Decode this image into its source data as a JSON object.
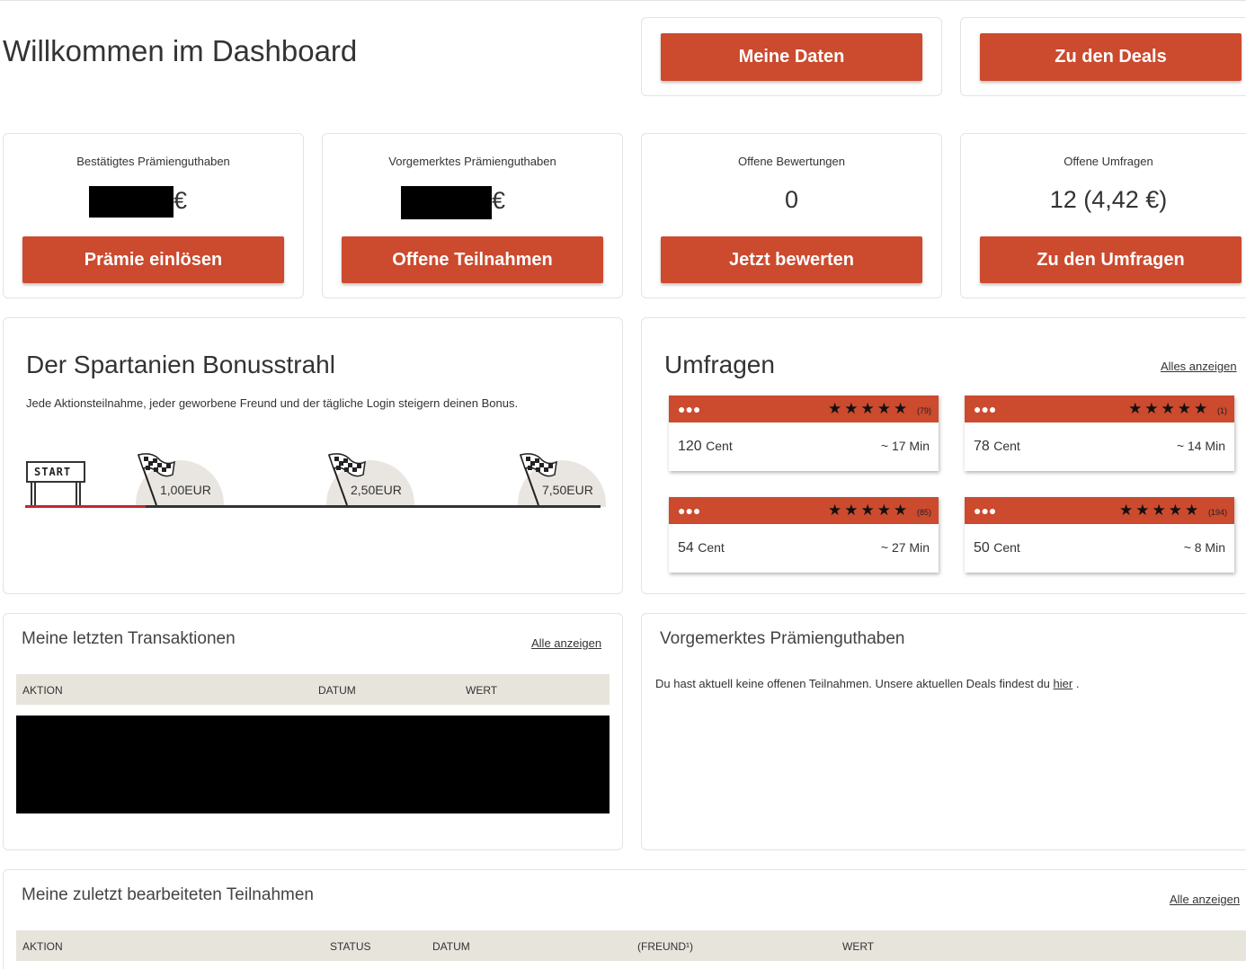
{
  "header": {
    "title": "Willkommen im Dashboard",
    "my_data_button": "Meine Daten",
    "deals_button": "Zu den Deals"
  },
  "stats": {
    "confirmed": {
      "label": "Bestätigtes Prämienguthaben",
      "currency": "€",
      "button": "Prämie einlösen"
    },
    "pending": {
      "label": "Vorgemerktes Prämienguthaben",
      "currency": "€",
      "button": "Offene Teilnahmen"
    },
    "reviews": {
      "label": "Offene Bewertungen",
      "value": "0",
      "button": "Jetzt bewerten"
    },
    "surveys": {
      "label": "Offene Umfragen",
      "value": "12 (4,42 €)",
      "button": "Zu den Umfragen"
    }
  },
  "bonus": {
    "title": "Der Spartanien Bonusstrahl",
    "description": "Jede Aktionsteilnahme, jeder geworbene Freund und der tägliche Login steigern deinen Bonus.",
    "start_label": "START",
    "milestones": [
      "1,00EUR",
      "2,50EUR",
      "7,50EUR"
    ],
    "progress_fraction": 0.21
  },
  "umfragen": {
    "title": "Umfragen",
    "show_all": "Alles anzeigen",
    "items": [
      {
        "stars": "★★★★★",
        "count": "(79)",
        "cent_value": "120",
        "cent_unit": "Cent",
        "duration": "~ 17 Min"
      },
      {
        "stars": "★★★★★",
        "count": "(1)",
        "cent_value": "78",
        "cent_unit": "Cent",
        "duration": "~ 14 Min"
      },
      {
        "stars": "★★★★★",
        "count": "(85)",
        "cent_value": "54",
        "cent_unit": "Cent",
        "duration": "~ 27 Min"
      },
      {
        "stars": "★★★★★",
        "count": "(194)",
        "cent_value": "50",
        "cent_unit": "Cent",
        "duration": "~ 8 Min"
      }
    ]
  },
  "transactions": {
    "title": "Meine letzten Transaktionen",
    "show_all": "Alle anzeigen",
    "columns": [
      "AKTION",
      "DATUM",
      "WERT"
    ]
  },
  "pending_section": {
    "title": "Vorgemerktes Prämienguthaben",
    "text": "Du hast aktuell keine offenen Teilnahmen. Unsere aktuellen Deals findest du",
    "link": "hier",
    "suffix": "."
  },
  "participations": {
    "title": "Meine zuletzt bearbeiteten Teilnahmen",
    "show_all": "Alle anzeigen",
    "columns": [
      "AKTION",
      "STATUS",
      "DATUM",
      "(FREUND¹)",
      "WERT"
    ]
  },
  "colors": {
    "accent": "#cc4a2e",
    "table_header": "#e7e4dc"
  }
}
